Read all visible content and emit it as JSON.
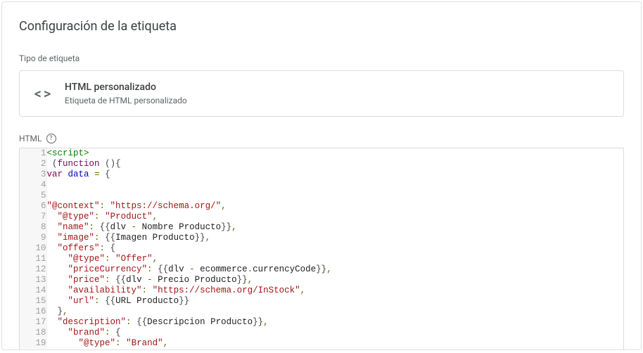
{
  "card": {
    "title": "Configuración de la etiqueta",
    "tagTypeLabel": "Tipo de etiqueta",
    "tagType": {
      "iconGlyph": "< >",
      "name": "HTML personalizado",
      "sub": "Etiqueta de HTML personalizado"
    },
    "editorLabel": "HTML",
    "helpGlyph": "?"
  },
  "code": {
    "lines": [
      {
        "n": 1,
        "segs": [
          [
            "tag",
            "<script>"
          ]
        ]
      },
      {
        "n": 2,
        "segs": [
          [
            "plain",
            " "
          ],
          [
            "brace",
            "("
          ],
          [
            "kw",
            "function"
          ],
          [
            "plain",
            " "
          ],
          [
            "brace",
            "(){"
          ]
        ]
      },
      {
        "n": 3,
        "segs": [
          [
            "kw",
            "var"
          ],
          [
            "plain",
            " "
          ],
          [
            "var",
            "data"
          ],
          [
            "plain",
            " "
          ],
          [
            "op",
            "="
          ],
          [
            "plain",
            " "
          ],
          [
            "brace",
            "{"
          ]
        ]
      },
      {
        "n": 4,
        "segs": []
      },
      {
        "n": 5,
        "segs": []
      },
      {
        "n": 6,
        "segs": [
          [
            "str",
            "\"@context\""
          ],
          [
            "op",
            ":"
          ],
          [
            "plain",
            " "
          ],
          [
            "str",
            "\"https://schema.org/\""
          ],
          [
            "op",
            ","
          ]
        ]
      },
      {
        "n": 7,
        "segs": [
          [
            "plain",
            "  "
          ],
          [
            "str",
            "\"@type\""
          ],
          [
            "op",
            ":"
          ],
          [
            "plain",
            " "
          ],
          [
            "str",
            "\"Product\""
          ],
          [
            "op",
            ","
          ]
        ]
      },
      {
        "n": 8,
        "segs": [
          [
            "plain",
            "  "
          ],
          [
            "str",
            "\"name\""
          ],
          [
            "op",
            ":"
          ],
          [
            "plain",
            " "
          ],
          [
            "brace",
            "{{"
          ],
          [
            "plain",
            "dlv "
          ],
          [
            "op",
            "-"
          ],
          [
            "plain",
            " Nombre Producto"
          ],
          [
            "brace",
            "}}"
          ],
          [
            "op",
            ","
          ]
        ]
      },
      {
        "n": 9,
        "segs": [
          [
            "plain",
            "  "
          ],
          [
            "str",
            "\"image\""
          ],
          [
            "op",
            ":"
          ],
          [
            "plain",
            " "
          ],
          [
            "brace",
            "{{"
          ],
          [
            "plain",
            "Imagen Producto"
          ],
          [
            "brace",
            "}}"
          ],
          [
            "op",
            ","
          ]
        ]
      },
      {
        "n": 10,
        "segs": [
          [
            "plain",
            "  "
          ],
          [
            "str",
            "\"offers\""
          ],
          [
            "op",
            ":"
          ],
          [
            "plain",
            " "
          ],
          [
            "brace",
            "{"
          ]
        ]
      },
      {
        "n": 11,
        "segs": [
          [
            "plain",
            "    "
          ],
          [
            "str",
            "\"@type\""
          ],
          [
            "op",
            ":"
          ],
          [
            "plain",
            " "
          ],
          [
            "str",
            "\"Offer\""
          ],
          [
            "op",
            ","
          ]
        ]
      },
      {
        "n": 12,
        "segs": [
          [
            "plain",
            "    "
          ],
          [
            "str",
            "\"priceCurrency\""
          ],
          [
            "op",
            ":"
          ],
          [
            "plain",
            " "
          ],
          [
            "brace",
            "{{"
          ],
          [
            "plain",
            "dlv "
          ],
          [
            "op",
            "-"
          ],
          [
            "plain",
            " ecommerce"
          ],
          [
            "op",
            "."
          ],
          [
            "plain",
            "currencyCode"
          ],
          [
            "brace",
            "}}"
          ],
          [
            "op",
            ","
          ]
        ]
      },
      {
        "n": 13,
        "segs": [
          [
            "plain",
            "    "
          ],
          [
            "str",
            "\"price\""
          ],
          [
            "op",
            ":"
          ],
          [
            "plain",
            " "
          ],
          [
            "brace",
            "{{"
          ],
          [
            "plain",
            "dlv "
          ],
          [
            "op",
            "-"
          ],
          [
            "plain",
            " Precio Producto"
          ],
          [
            "brace",
            "}}"
          ],
          [
            "op",
            ","
          ]
        ]
      },
      {
        "n": 14,
        "segs": [
          [
            "plain",
            "    "
          ],
          [
            "str",
            "\"availability\""
          ],
          [
            "op",
            ":"
          ],
          [
            "plain",
            " "
          ],
          [
            "str",
            "\"https://schema.org/InStock\""
          ],
          [
            "op",
            ","
          ]
        ]
      },
      {
        "n": 15,
        "segs": [
          [
            "plain",
            "    "
          ],
          [
            "str",
            "\"url\""
          ],
          [
            "op",
            ":"
          ],
          [
            "plain",
            " "
          ],
          [
            "brace",
            "{{"
          ],
          [
            "plain",
            "URL Producto"
          ],
          [
            "brace",
            "}}"
          ]
        ]
      },
      {
        "n": 16,
        "segs": [
          [
            "plain",
            "  "
          ],
          [
            "brace",
            "}"
          ],
          [
            "op",
            ","
          ]
        ]
      },
      {
        "n": 17,
        "segs": [
          [
            "plain",
            "  "
          ],
          [
            "str",
            "\"description\""
          ],
          [
            "op",
            ":"
          ],
          [
            "plain",
            " "
          ],
          [
            "brace",
            "{{"
          ],
          [
            "plain",
            "Descripcion Producto"
          ],
          [
            "brace",
            "}}"
          ],
          [
            "op",
            ","
          ]
        ]
      },
      {
        "n": 18,
        "segs": [
          [
            "plain",
            "    "
          ],
          [
            "str",
            "\"brand\""
          ],
          [
            "op",
            ":"
          ],
          [
            "plain",
            " "
          ],
          [
            "brace",
            "{"
          ]
        ]
      },
      {
        "n": 19,
        "segs": [
          [
            "plain",
            "      "
          ],
          [
            "str",
            "\"@type\""
          ],
          [
            "op",
            ":"
          ],
          [
            "plain",
            " "
          ],
          [
            "str",
            "\"Brand\""
          ],
          [
            "op",
            ","
          ]
        ]
      }
    ]
  },
  "tokenClassMap": {
    "tag": "t-tag",
    "kw": "t-kw",
    "kw2": "t-kw2",
    "var": "t-var",
    "op": "t-op",
    "str": "t-str",
    "brace": "t-brace",
    "plain": "t-plain"
  }
}
